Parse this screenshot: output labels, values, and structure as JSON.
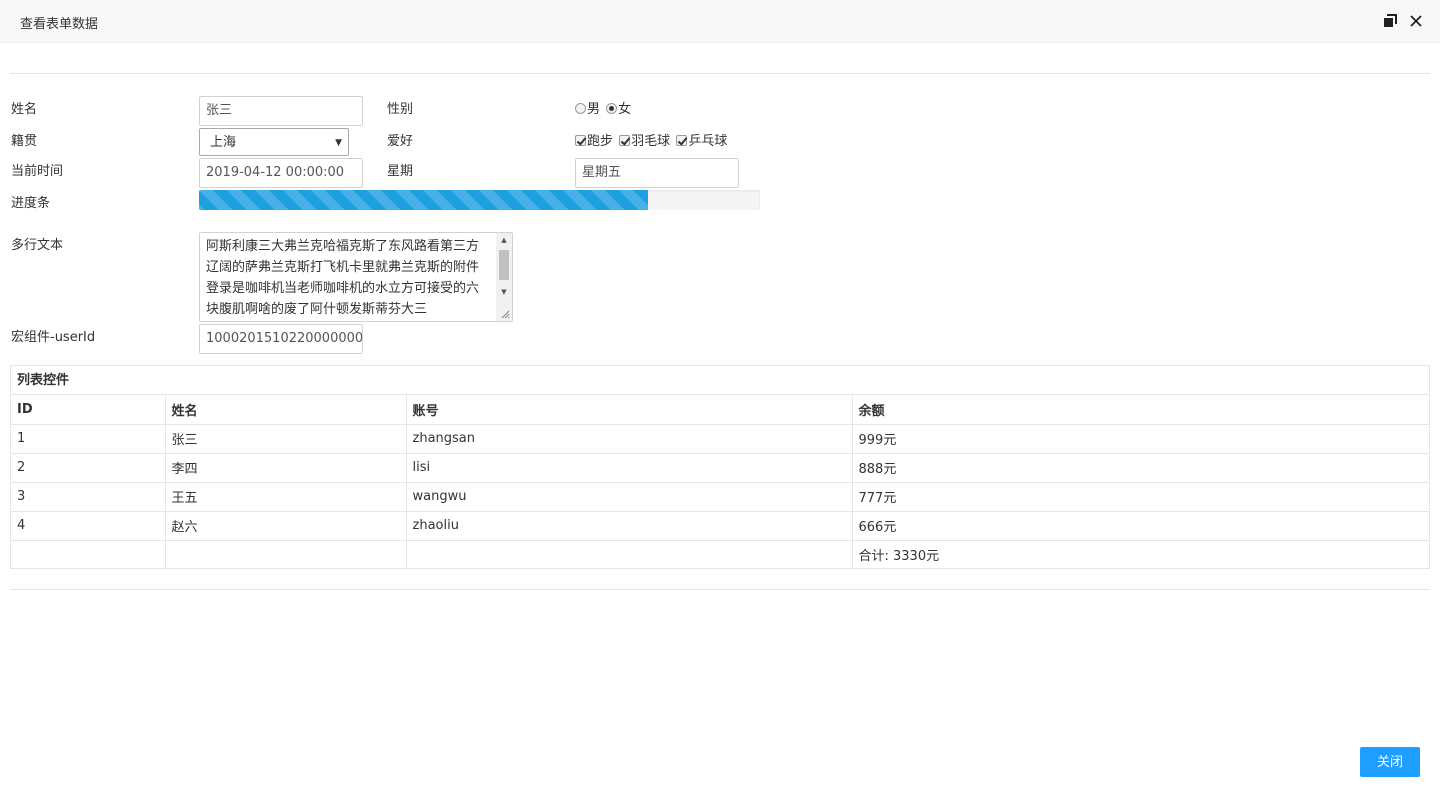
{
  "window": {
    "title": "查看表单数据",
    "maximize_icon": "maximize-icon",
    "close_icon": "close-icon"
  },
  "form": {
    "name": {
      "label": "姓名",
      "value": "张三"
    },
    "gender": {
      "label": "性别",
      "options": [
        "男",
        "女"
      ],
      "selected": "女"
    },
    "native_place": {
      "label": "籍贯",
      "value": "上海"
    },
    "hobbies": {
      "label": "爱好",
      "options": [
        "跑步",
        "羽毛球",
        "乒乓球"
      ],
      "checked": [
        "跑步",
        "羽毛球",
        "乒乓球"
      ]
    },
    "current_time": {
      "label": "当前时间",
      "value": "2019-04-12 00:00:00"
    },
    "weekday": {
      "label": "星期",
      "value": "星期五"
    },
    "progress": {
      "label": "进度条",
      "percent": 80
    },
    "multiline": {
      "label": "多行文本",
      "value": "阿斯利康三大弗兰克哈福克斯了东风路看第三方辽阔的萨弗兰克斯打飞机卡里就弗兰克斯的附件登录是咖啡机当老师咖啡机的水立方可接受的六块腹肌啊啥的废了阿什顿发斯蒂芬大三"
    },
    "userid": {
      "label": "宏组件-userId",
      "value": "1000201510220000000"
    }
  },
  "list": {
    "title": "列表控件",
    "columns": [
      "ID",
      "姓名",
      "账号",
      "余额"
    ],
    "rows": [
      [
        "1",
        "张三",
        "zhangsan",
        "999元"
      ],
      [
        "2",
        "李四",
        "lisi",
        "888元"
      ],
      [
        "3",
        "王五",
        "wangwu",
        "777元"
      ],
      [
        "4",
        "赵六",
        "zhaoliu",
        "666元"
      ]
    ],
    "total": "合计: 3330元"
  },
  "footer": {
    "close_label": "关闭"
  },
  "colors": {
    "primary": "#1e9fff",
    "progress": "#1e9fe0"
  }
}
